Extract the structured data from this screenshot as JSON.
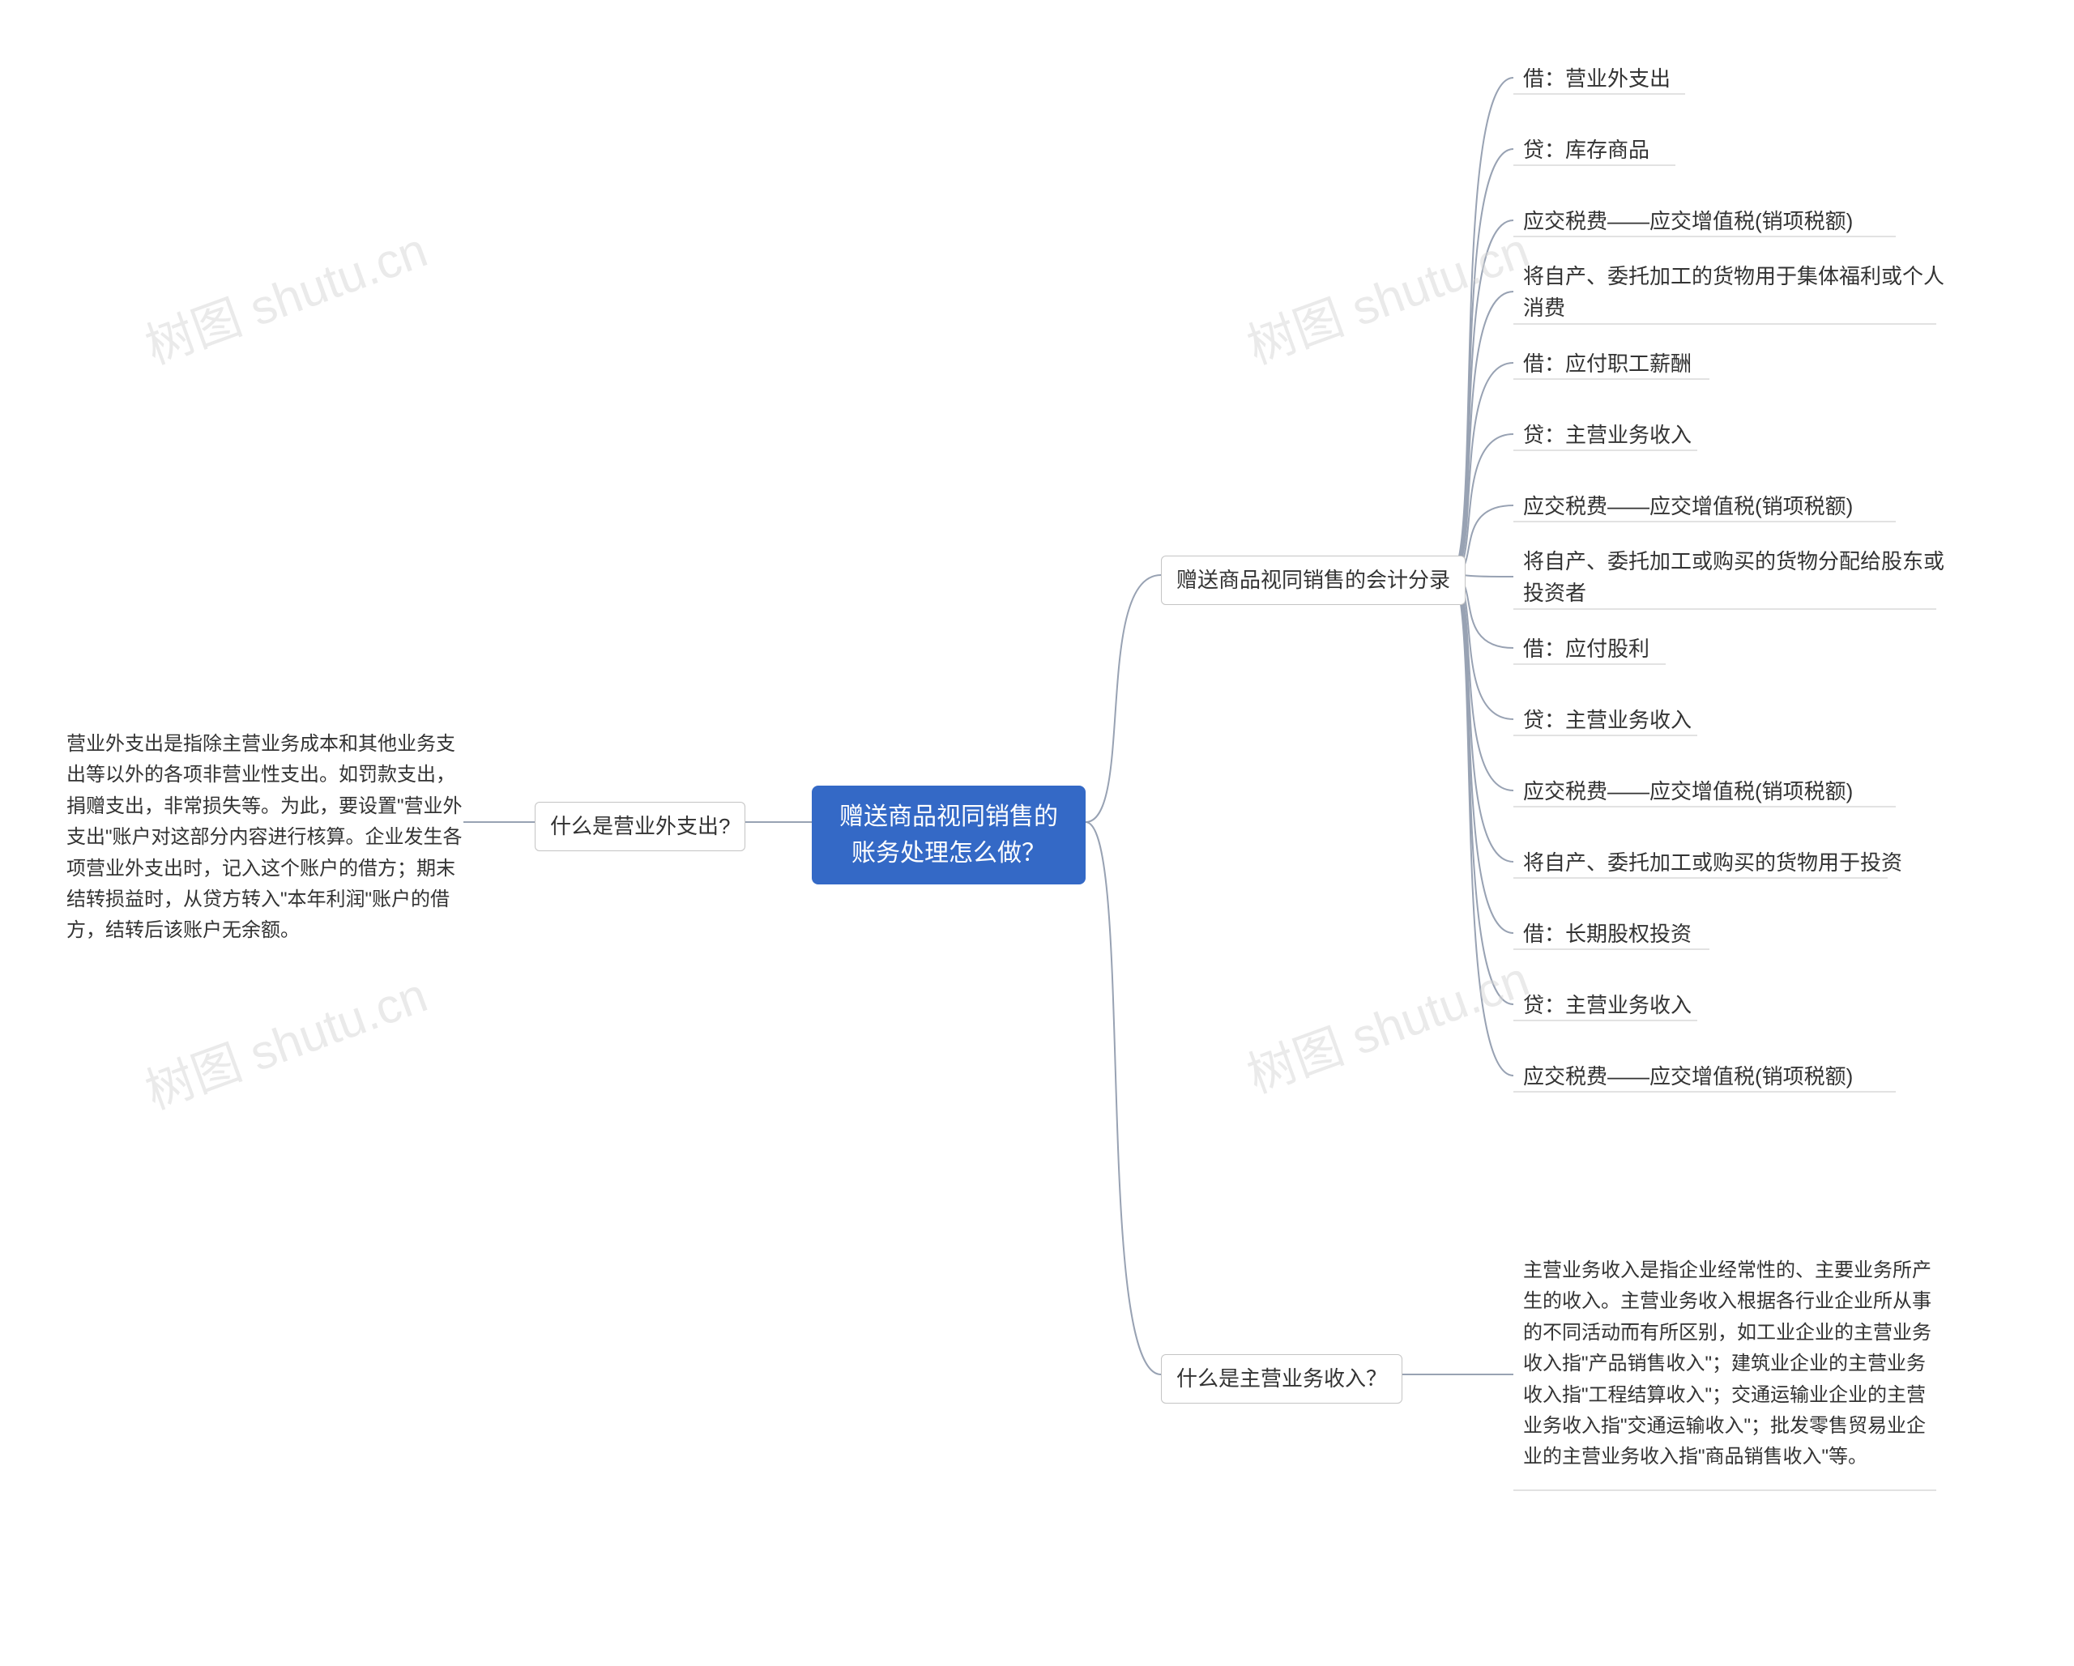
{
  "root": "赠送商品视同销售的账务处理怎么做？",
  "left": {
    "branch_label": "什么是营业外支出?",
    "para": "营业外支出是指除主营业务成本和其他业务支出等以外的各项非营业性支出。如罚款支出，捐赠支出，非常损失等。为此，要设置\"营业外支出\"账户对这部分内容进行核算。企业发生各项营业外支出时，记入这个账户的借方；期末结转损益时，从贷方转入\"本年利润\"账户的借方，结转后该账户无余额。"
  },
  "right": {
    "branch1_label": "赠送商品视同销售的会计分录",
    "branch1_items": [
      "借：营业外支出",
      "贷：库存商品",
      "应交税费——应交增值税(销项税额)",
      "将自产、委托加工的货物用于集体福利或个人消费",
      "借：应付职工薪酬",
      "贷：主营业务收入",
      "应交税费——应交增值税(销项税额)",
      "将自产、委托加工或购买的货物分配给股东或投资者",
      "借：应付股利",
      "贷：主营业务收入",
      "应交税费——应交增值税(销项税额)",
      "将自产、委托加工或购买的货物用于投资",
      "借：长期股权投资",
      "贷：主营业务收入",
      "应交税费——应交增值税(销项税额)"
    ],
    "branch2_label": "什么是主营业务收入？",
    "branch2_para": "主营业务收入是指企业经常性的、主要业务所产生的收入。主营业务收入根据各行业企业所从事的不同活动而有所区别，如工业企业的主营业务收入指\"产品销售收入\"；建筑业企业的主营业务收入指\"工程结算收入\"；交通运输业企业的主营业务收入指\"交通运输收入\"；批发零售贸易业企业的主营业务收入指\"商品销售收入\"等。"
  },
  "watermark": "树图 shutu.cn"
}
